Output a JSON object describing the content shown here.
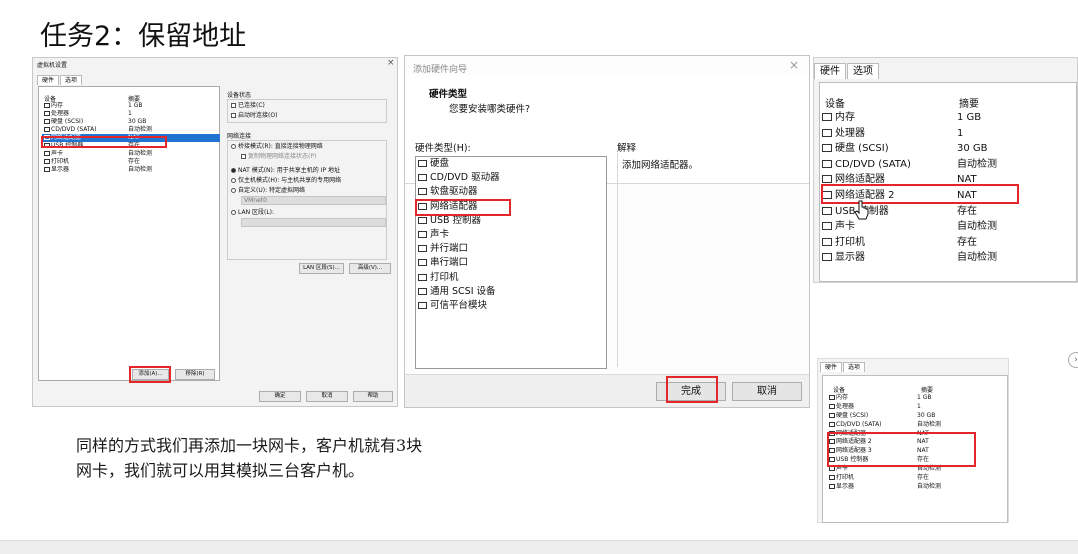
{
  "slide": {
    "title": "任务2：保留地址",
    "note_line1": "同样的方式我们再添加一块网卡，客户机就有3块",
    "note_line2": "网卡，我们就可以用其模拟三台客户机。"
  },
  "vm_settings": {
    "title": "虚拟机设置",
    "close": "×",
    "tabs": [
      "硬件",
      "选项"
    ],
    "col_device": "设备",
    "col_summary": "摘要",
    "devices": [
      {
        "icon": "memory-icon",
        "name": "内存",
        "summary": "1 GB"
      },
      {
        "icon": "cpu-icon",
        "name": "处理器",
        "summary": "1"
      },
      {
        "icon": "disk-icon",
        "name": "硬盘 (SCSI)",
        "summary": "30 GB"
      },
      {
        "icon": "cd-icon",
        "name": "CD/DVD (SATA)",
        "summary": "自动检测"
      },
      {
        "icon": "network-icon",
        "name": "网络适配器",
        "summary": "NAT",
        "selected": true
      },
      {
        "icon": "usb-icon",
        "name": "USB 控制器",
        "summary": "存在"
      },
      {
        "icon": "sound-icon",
        "name": "声卡",
        "summary": "自动检测"
      },
      {
        "icon": "printer-icon",
        "name": "打印机",
        "summary": "存在"
      },
      {
        "icon": "display-icon",
        "name": "显示器",
        "summary": "自动检测"
      }
    ],
    "device_status": {
      "heading": "设备状态",
      "connected": "已连接(C)",
      "connect_on_power": "启动时连接(O)"
    },
    "network": {
      "heading": "网络连接",
      "bridged": "桥接模式(R): 直接连接物理网络",
      "replicate": "复制物理网络连接状态(P)",
      "nat": "NAT 模式(N): 用于共享主机的 IP 地址",
      "host_only": "仅主机模式(H): 与主机共享的专用网络",
      "custom": "自定义(U): 特定虚拟网络",
      "custom_value": "VMnet0",
      "lan": "LAN 区段(L):"
    },
    "lan_segment_button": "LAN 区段(S)...",
    "advanced_button": "高级(V)...",
    "add_button": "添加(A)...",
    "remove_button": "移除(R)",
    "ok_button": "确定",
    "cancel_button": "取消",
    "help_button": "帮助"
  },
  "wizard": {
    "title": "添加硬件向导",
    "close": "×",
    "heading": "硬件类型",
    "subheading": "您要安装哪类硬件?",
    "types_label": "硬件类型(H):",
    "desc_label": "解释",
    "description": "添加网络适配器。",
    "types": [
      {
        "icon": "disk-icon",
        "name": "硬盘"
      },
      {
        "icon": "cd-icon",
        "name": "CD/DVD 驱动器"
      },
      {
        "icon": "floppy-icon",
        "name": "软盘驱动器"
      },
      {
        "icon": "network-icon",
        "name": "网络适配器"
      },
      {
        "icon": "usb-icon",
        "name": "USB 控制器"
      },
      {
        "icon": "sound-icon",
        "name": "声卡"
      },
      {
        "icon": "parallel-port-icon",
        "name": "并行端口"
      },
      {
        "icon": "serial-port-icon",
        "name": "串行端口"
      },
      {
        "icon": "printer-icon",
        "name": "打印机"
      },
      {
        "icon": "scsi-icon",
        "name": "通用 SCSI 设备"
      },
      {
        "icon": "tpm-icon",
        "name": "可信平台模块"
      }
    ],
    "finish_button": "完成",
    "cancel_button": "取消"
  },
  "hardware_large": {
    "tabs": [
      "硬件",
      "选项"
    ],
    "col_device": "设备",
    "col_summary": "摘要",
    "devices": [
      {
        "icon": "memory-icon",
        "name": "内存",
        "summary": "1 GB"
      },
      {
        "icon": "cpu-icon",
        "name": "处理器",
        "summary": "1"
      },
      {
        "icon": "disk-icon",
        "name": "硬盘 (SCSI)",
        "summary": "30 GB"
      },
      {
        "icon": "cd-icon",
        "name": "CD/DVD (SATA)",
        "summary": "自动检测"
      },
      {
        "icon": "network-icon",
        "name": "网络适配器",
        "summary": "NAT"
      },
      {
        "icon": "network-icon",
        "name": "网络适配器 2",
        "summary": "NAT"
      },
      {
        "icon": "usb-icon",
        "name": "USB 控制器",
        "summary": "存在"
      },
      {
        "icon": "sound-icon",
        "name": "声卡",
        "summary": "自动检测"
      },
      {
        "icon": "printer-icon",
        "name": "打印机",
        "summary": "存在"
      },
      {
        "icon": "display-icon",
        "name": "显示器",
        "summary": "自动检测"
      }
    ]
  },
  "hardware_small": {
    "tabs": [
      "硬件",
      "选项"
    ],
    "col_device": "设备",
    "col_summary": "摘要",
    "devices": [
      {
        "icon": "memory-icon",
        "name": "内存",
        "summary": "1 GB"
      },
      {
        "icon": "cpu-icon",
        "name": "处理器",
        "summary": "1"
      },
      {
        "icon": "disk-icon",
        "name": "硬盘 (SCSI)",
        "summary": "30 GB"
      },
      {
        "icon": "cd-icon",
        "name": "CD/DVD (SATA)",
        "summary": "自动检测"
      },
      {
        "icon": "network-icon",
        "name": "网络适配器",
        "summary": "NAT"
      },
      {
        "icon": "network-icon",
        "name": "网络适配器 2",
        "summary": "NAT"
      },
      {
        "icon": "network-icon",
        "name": "网络适配器 3",
        "summary": "NAT"
      },
      {
        "icon": "usb-icon",
        "name": "USB 控制器",
        "summary": "存在"
      },
      {
        "icon": "sound-icon",
        "name": "声卡",
        "summary": "自动检测"
      },
      {
        "icon": "printer-icon",
        "name": "打印机",
        "summary": "存在"
      },
      {
        "icon": "display-icon",
        "name": "显示器",
        "summary": "自动检测"
      }
    ]
  },
  "colors": {
    "highlight": "#e2262a",
    "selection": "#1f74d1"
  }
}
